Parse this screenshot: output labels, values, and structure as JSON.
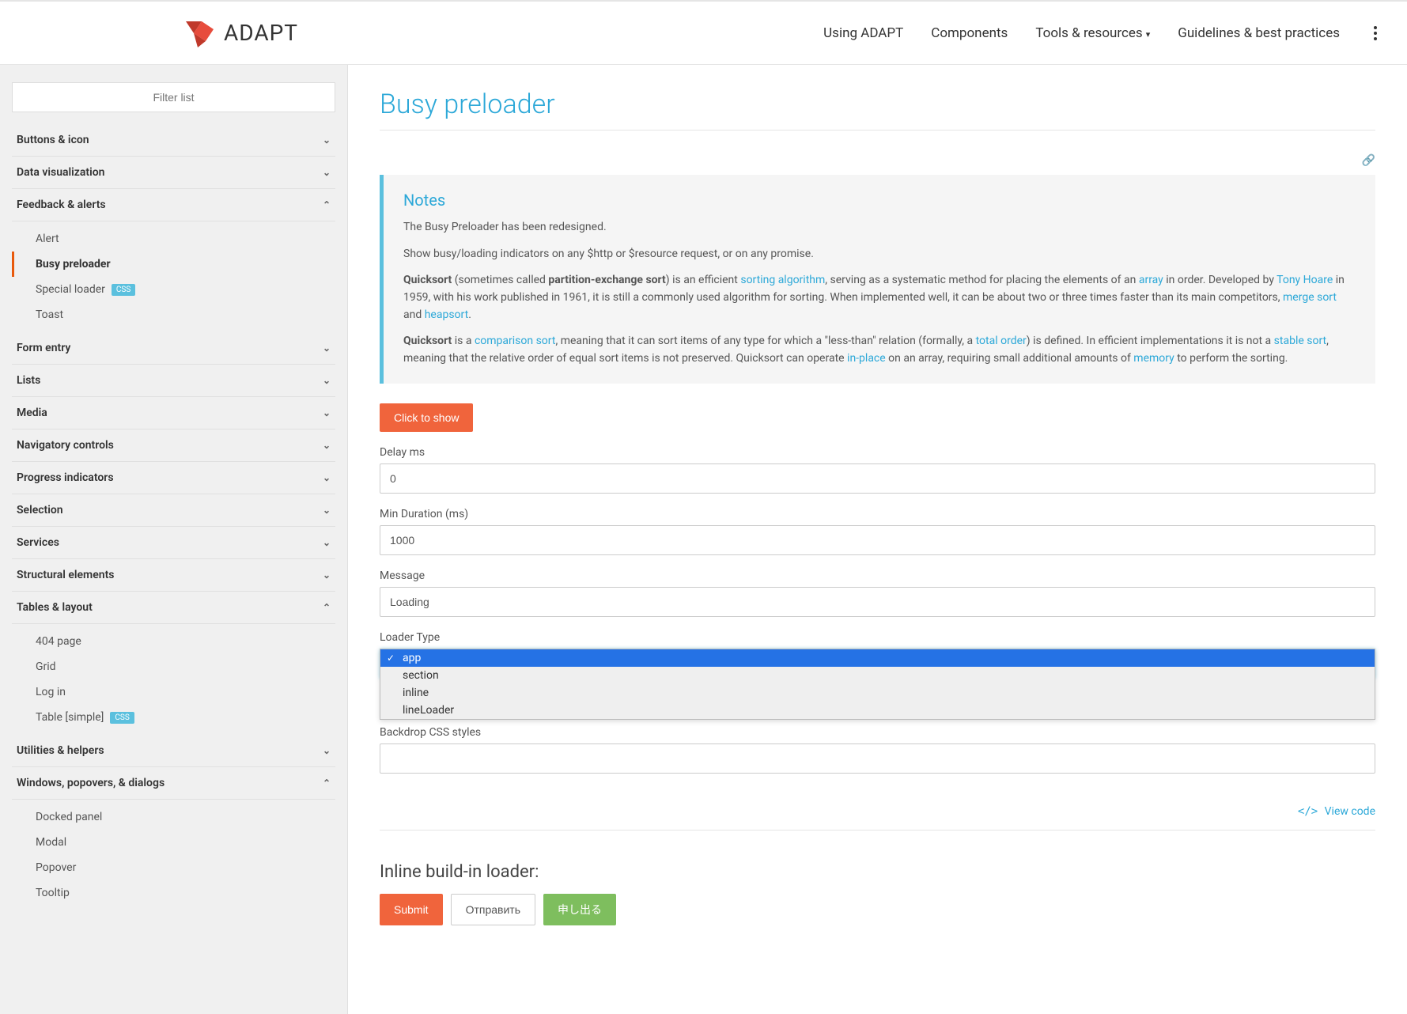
{
  "header": {
    "brand": "ADAPT",
    "nav": [
      "Using ADAPT",
      "Components",
      "Tools & resources",
      "Guidelines & best practices"
    ]
  },
  "sidebar": {
    "search_placeholder": "Filter list",
    "sections": {
      "s0": {
        "label": "Buttons & icon"
      },
      "s1": {
        "label": "Data visualization"
      },
      "s2": {
        "label": "Feedback & alerts",
        "items": [
          {
            "label": "Alert"
          },
          {
            "label": "Busy preloader",
            "active": true
          },
          {
            "label": "Special loader",
            "css": true
          },
          {
            "label": "Toast"
          }
        ]
      },
      "s3": {
        "label": "Form entry"
      },
      "s4": {
        "label": "Lists"
      },
      "s5": {
        "label": "Media"
      },
      "s6": {
        "label": "Navigatory controls"
      },
      "s7": {
        "label": "Progress indicators"
      },
      "s8": {
        "label": "Selection"
      },
      "s9": {
        "label": "Services"
      },
      "s10": {
        "label": "Structural elements"
      },
      "s11": {
        "label": "Tables & layout",
        "items": [
          {
            "label": "404 page"
          },
          {
            "label": "Grid"
          },
          {
            "label": "Log in"
          },
          {
            "label": "Table [simple]",
            "css": true
          }
        ]
      },
      "s12": {
        "label": "Utilities & helpers"
      },
      "s13": {
        "label": "Windows, popovers, & dialogs",
        "items": [
          {
            "label": "Docked panel"
          },
          {
            "label": "Modal"
          },
          {
            "label": "Popover"
          },
          {
            "label": "Tooltip"
          }
        ]
      }
    },
    "css_badge": "CSS"
  },
  "main": {
    "title": "Busy preloader",
    "notes": {
      "heading": "Notes",
      "p1": "The Busy Preloader has been redesigned.",
      "p2": "Show busy/loading indicators on any $http or $resource request, or on any promise.",
      "p3_a": "Quicksort",
      "p3_b": " (sometimes called ",
      "p3_c": "partition-exchange sort",
      "p3_d": ") is an efficient ",
      "p3_link1": "sorting algorithm",
      "p3_e": ", serving as a systematic method for placing the elements of an ",
      "p3_link2": "array",
      "p3_f": " in order. Developed by ",
      "p3_link3": "Tony Hoare",
      "p3_g": " in 1959, with his work published in 1961, it is still a commonly used algorithm for sorting. When implemented well, it can be about two or three times faster than its main competitors, ",
      "p3_link4": "merge sort",
      "p3_h": " and ",
      "p3_link5": "heapsort",
      "p3_i": ".",
      "p4_a": "Quicksort",
      "p4_b": " is a ",
      "p4_link1": "comparison sort",
      "p4_c": ", meaning that it can sort items of any type for which a \"less-than\" relation (formally, a ",
      "p4_link2": "total order",
      "p4_d": ") is defined. In efficient implementations it is not a ",
      "p4_link3": "stable sort",
      "p4_e": ", meaning that the relative order of equal sort items is not preserved. Quicksort can operate ",
      "p4_link4": "in-place",
      "p4_f": " on an array, requiring small additional amounts of ",
      "p4_link5": "memory",
      "p4_g": " to perform the sorting."
    },
    "click_to_show": "Click to show",
    "fields": {
      "delay_label": "Delay ms",
      "delay_value": "0",
      "mindur_label": "Min Duration (ms)",
      "mindur_value": "1000",
      "message_label": "Message",
      "message_value": "Loading",
      "loader_type_label": "Loader Type",
      "loader_options": [
        "app",
        "section",
        "inline",
        "lineLoader"
      ],
      "backdrop_label": "Backdrop CSS styles"
    },
    "view_code": "View code",
    "inline_section": {
      "title": "Inline build-in loader:",
      "buttons": {
        "submit": "Submit",
        "ru": "Отправить",
        "jp": "申し出る"
      }
    }
  }
}
